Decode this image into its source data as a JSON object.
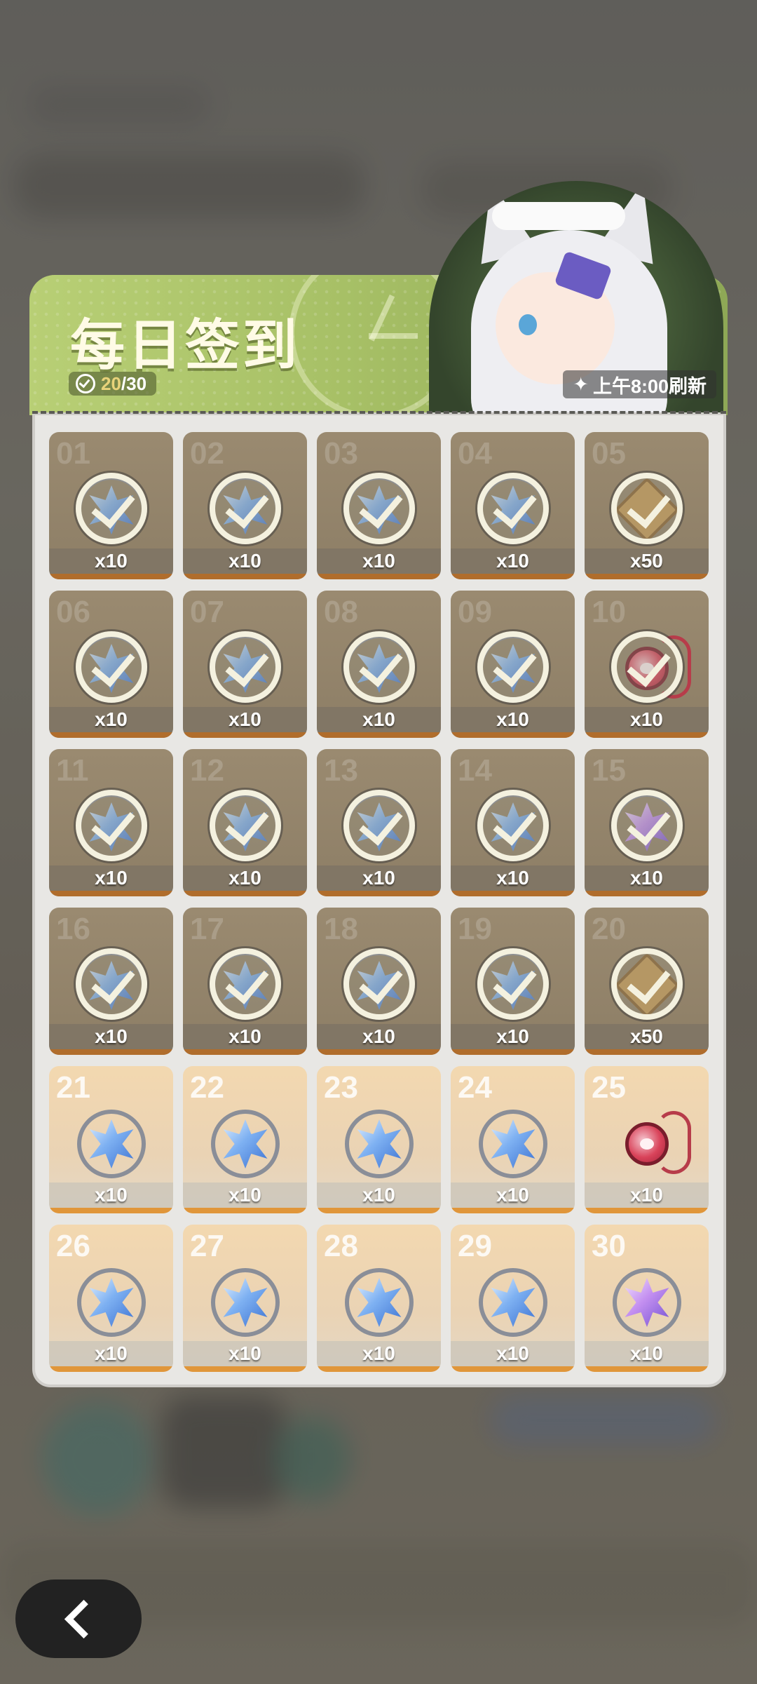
{
  "header": {
    "title": "每日签到",
    "progress_current": "20",
    "progress_total": "/30",
    "refresh_text": "上午8:00刷新"
  },
  "days": [
    {
      "day": "01",
      "qty": "x10",
      "reward": "blue-crystal",
      "claimed": true
    },
    {
      "day": "02",
      "qty": "x10",
      "reward": "blue-crystal",
      "claimed": true
    },
    {
      "day": "03",
      "qty": "x10",
      "reward": "blue-crystal",
      "claimed": true
    },
    {
      "day": "04",
      "qty": "x10",
      "reward": "blue-crystal",
      "claimed": true
    },
    {
      "day": "05",
      "qty": "x50",
      "reward": "gold-ticket",
      "claimed": true
    },
    {
      "day": "06",
      "qty": "x10",
      "reward": "blue-crystal",
      "claimed": true
    },
    {
      "day": "07",
      "qty": "x10",
      "reward": "blue-crystal",
      "claimed": true
    },
    {
      "day": "08",
      "qty": "x10",
      "reward": "blue-crystal",
      "claimed": true
    },
    {
      "day": "09",
      "qty": "x10",
      "reward": "blue-crystal",
      "claimed": true
    },
    {
      "day": "10",
      "qty": "x10",
      "reward": "paw-charm",
      "claimed": true
    },
    {
      "day": "11",
      "qty": "x10",
      "reward": "blue-crystal",
      "claimed": true
    },
    {
      "day": "12",
      "qty": "x10",
      "reward": "blue-crystal",
      "claimed": true
    },
    {
      "day": "13",
      "qty": "x10",
      "reward": "blue-crystal",
      "claimed": true
    },
    {
      "day": "14",
      "qty": "x10",
      "reward": "blue-crystal",
      "claimed": true
    },
    {
      "day": "15",
      "qty": "x10",
      "reward": "purple-crystal",
      "claimed": true
    },
    {
      "day": "16",
      "qty": "x10",
      "reward": "blue-crystal",
      "claimed": true
    },
    {
      "day": "17",
      "qty": "x10",
      "reward": "blue-crystal",
      "claimed": true
    },
    {
      "day": "18",
      "qty": "x10",
      "reward": "blue-crystal",
      "claimed": true
    },
    {
      "day": "19",
      "qty": "x10",
      "reward": "blue-crystal",
      "claimed": true
    },
    {
      "day": "20",
      "qty": "x50",
      "reward": "gold-ticket",
      "claimed": true
    },
    {
      "day": "21",
      "qty": "x10",
      "reward": "blue-crystal",
      "claimed": false
    },
    {
      "day": "22",
      "qty": "x10",
      "reward": "blue-crystal",
      "claimed": false
    },
    {
      "day": "23",
      "qty": "x10",
      "reward": "blue-crystal",
      "claimed": false
    },
    {
      "day": "24",
      "qty": "x10",
      "reward": "blue-crystal",
      "claimed": false
    },
    {
      "day": "25",
      "qty": "x10",
      "reward": "paw-charm",
      "claimed": false
    },
    {
      "day": "26",
      "qty": "x10",
      "reward": "blue-crystal",
      "claimed": false
    },
    {
      "day": "27",
      "qty": "x10",
      "reward": "blue-crystal",
      "claimed": false
    },
    {
      "day": "28",
      "qty": "x10",
      "reward": "blue-crystal",
      "claimed": false
    },
    {
      "day": "29",
      "qty": "x10",
      "reward": "blue-crystal",
      "claimed": false
    },
    {
      "day": "30",
      "qty": "x10",
      "reward": "purple-crystal",
      "claimed": false
    }
  ],
  "colors": {
    "header_green": "#a7c066",
    "claimed_tile": "#8d7e66",
    "unclaimed_tile": "#f3d8b0",
    "tile_strip": "#e0963a"
  },
  "icons": {
    "back": "chevron-left-icon",
    "progress": "check-circle-icon",
    "refresh": "sparkle-icon"
  }
}
